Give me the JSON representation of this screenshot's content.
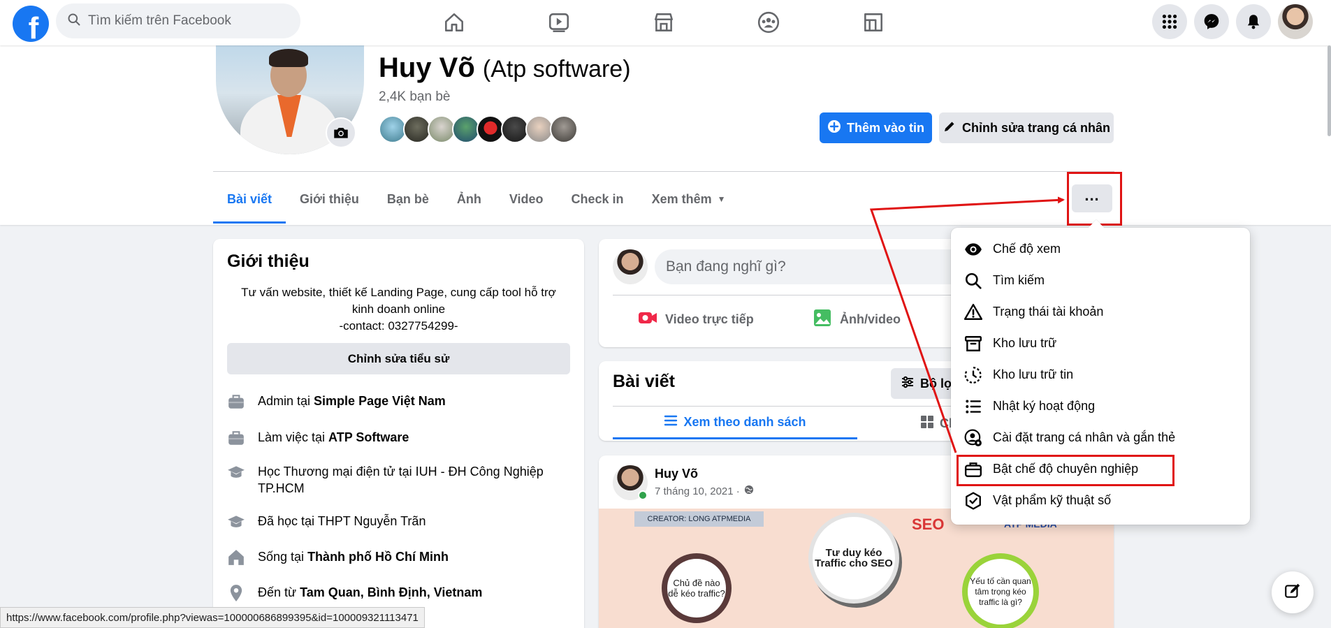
{
  "topbar": {
    "search_placeholder": "Tìm kiếm trên Facebook",
    "nav_icons": [
      "home-icon",
      "watch-icon",
      "marketplace-icon",
      "groups-icon",
      "gaming-icon"
    ],
    "right_icons": [
      "menu-grid-icon",
      "messenger-icon",
      "notifications-icon",
      "account-avatar"
    ],
    "brand_color": "#1877f2"
  },
  "profile": {
    "name": "Huy Võ",
    "alt_name": "(Atp software)",
    "friend_count": "2,4K bạn bè",
    "add_story_label": "Thêm vào tin",
    "edit_profile_label": "Chỉnh sửa trang cá nhân"
  },
  "tabs": [
    {
      "label": "Bài viết",
      "active": true
    },
    {
      "label": "Giới thiệu"
    },
    {
      "label": "Bạn bè"
    },
    {
      "label": "Ảnh"
    },
    {
      "label": "Video"
    },
    {
      "label": "Check in"
    },
    {
      "label": "Xem thêm"
    }
  ],
  "more_button_label": "...",
  "intro": {
    "title": "Giới thiệu",
    "bio_line1": "Tư vấn website, thiết kế Landing Page, cung cấp tool hỗ trợ",
    "bio_line2": "kinh doanh online",
    "bio_line3": "-contact: 0327754299-",
    "edit_bio_label": "Chỉnh sửa tiểu sử",
    "items": [
      {
        "prefix": "Admin tại ",
        "bold": "Simple Page Việt Nam",
        "icon": "briefcase-icon"
      },
      {
        "prefix": "Làm việc tại ",
        "bold": "ATP Software",
        "icon": "briefcase-icon"
      },
      {
        "prefix": "Học Thương mại điện tử tại IUH - ĐH Công Nghiệp TP.HCM",
        "bold": "",
        "icon": "graduation-cap-icon"
      },
      {
        "prefix": "Đã học tại THPT Nguyễn Trãn",
        "bold": "",
        "icon": "graduation-cap-icon"
      },
      {
        "prefix": "Sống tại ",
        "bold": "Thành phố Hồ Chí Minh",
        "icon": "home-icon"
      },
      {
        "prefix": "Đến từ ",
        "bold": "Tam Quan, Bình Định, Vietnam",
        "icon": "location-pin-icon"
      }
    ]
  },
  "composer": {
    "placeholder": "Bạn đang nghĩ gì?",
    "live_label": "Video trực tiếp",
    "photo_label": "Ảnh/video"
  },
  "posts_section": {
    "title": "Bài viết",
    "filter_label": "Bộ lọ",
    "list_view_label": "Xem theo danh sách",
    "grid_view_label": "Ch"
  },
  "post": {
    "author": "Huy Võ",
    "date": "7 tháng 10, 2021 ·",
    "image": {
      "creator_tag": "CREATOR: LONG ATPMEDIA",
      "bubble_left": "Chủ đề nào dễ kéo traffic?",
      "bubble_center": "Tư duy kéo Traffic cho SEO",
      "bubble_right": "Yếu tố cần quan tâm trọng kéo traffic là gì?",
      "seo_text": "SEO",
      "atp_text": "ATP MEDIA"
    }
  },
  "menu": {
    "items": [
      {
        "label": "Chế độ xem",
        "icon": "eye-icon"
      },
      {
        "label": "Tìm kiếm",
        "icon": "search-icon"
      },
      {
        "label": "Trạng thái tài khoản",
        "icon": "warning-icon"
      },
      {
        "label": "Kho lưu trữ",
        "icon": "archive-icon"
      },
      {
        "label": "Kho lưu trữ tin",
        "icon": "story-archive-icon"
      },
      {
        "label": "Nhật ký hoạt động",
        "icon": "activity-log-icon"
      },
      {
        "label": "Cài đặt trang cá nhân và gắn thẻ",
        "icon": "profile-settings-icon"
      },
      {
        "label": "Bật chế độ chuyên nghiệp",
        "icon": "professional-mode-icon"
      },
      {
        "label": "Vật phẩm kỹ thuật số",
        "icon": "digital-collectibles-icon"
      }
    ]
  },
  "status_url": "https://www.facebook.com/profile.php?viewas=100000686899395&id=100009321113471",
  "annotation_color": "#e01414"
}
